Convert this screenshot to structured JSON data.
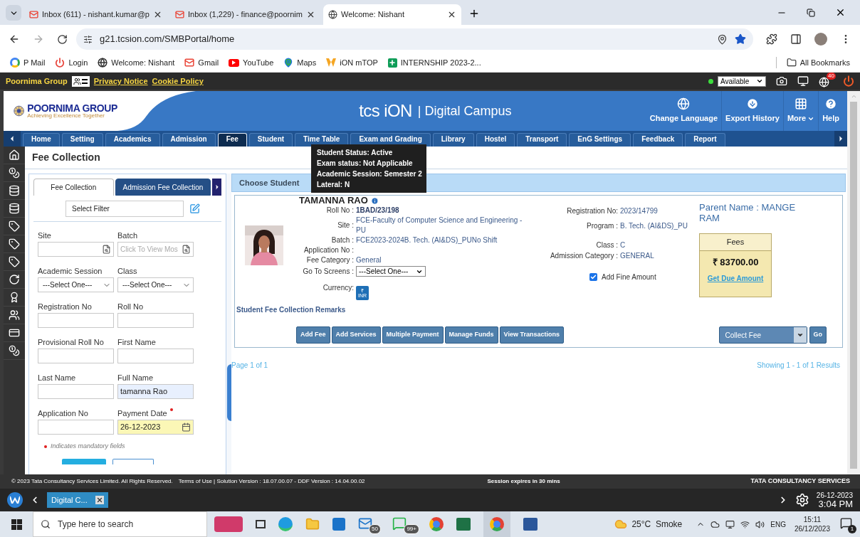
{
  "browser": {
    "tabs": [
      {
        "title": "Inbox (611) - nishant.kumar@p",
        "selected": false,
        "kind": "mail"
      },
      {
        "title": "Inbox (1,229) - finance@poornim",
        "selected": false,
        "kind": "mail"
      },
      {
        "title": "Welcome: Nishant",
        "selected": true,
        "kind": "globe"
      }
    ],
    "address": "g21.tcsion.com/SMBPortal/home",
    "bookmarks": [
      {
        "label": "P Mail",
        "kind": "google"
      },
      {
        "label": "Login",
        "kind": "power"
      },
      {
        "label": "Welcome: Nishant",
        "kind": "globe"
      },
      {
        "label": "Gmail",
        "kind": "mail"
      },
      {
        "label": "YouTube",
        "kind": "youtube"
      },
      {
        "label": "Maps",
        "kind": "maps"
      },
      {
        "label": "iON mTOP",
        "kind": "ion"
      },
      {
        "label": "INTERNSHIP 2023-2...",
        "kind": "sheet"
      }
    ],
    "all_bookmarks": "All Bookmarks"
  },
  "portal_bar": {
    "org": "Poornima Group",
    "links": [
      "Privacy Notice",
      "Cookie Policy"
    ],
    "status": "Available",
    "notification_count": "40"
  },
  "header": {
    "logo_name": "POORNIMA GROUP",
    "logo_tagline": "Achieving Excellence Together",
    "brand": "tcs iON",
    "product": "| Digital Campus",
    "actions": [
      {
        "label": "Change Language",
        "kind": "globe"
      },
      {
        "label": "Export History",
        "kind": "download"
      },
      {
        "label": "More",
        "kind": "grid"
      },
      {
        "label": "Help",
        "kind": "help"
      }
    ]
  },
  "nav": [
    {
      "label": "Home",
      "selected": false
    },
    {
      "label": "Setting",
      "selected": false
    },
    {
      "label": "Academics",
      "selected": false
    },
    {
      "label": "Admission",
      "selected": false
    },
    {
      "label": "Fee",
      "selected": true
    },
    {
      "label": "Student",
      "selected": false
    },
    {
      "label": "Time Table",
      "selected": false
    },
    {
      "label": "Exam and Grading",
      "selected": false
    },
    {
      "label": "Library",
      "selected": false
    },
    {
      "label": "Hostel",
      "selected": false
    },
    {
      "label": "Transport",
      "selected": false
    },
    {
      "label": "EnG Settings",
      "selected": false
    },
    {
      "label": "Feedback",
      "selected": false
    },
    {
      "label": "Report",
      "selected": false
    }
  ],
  "page_title": "Fee Collection",
  "filter_panel": {
    "tabs": [
      {
        "label": "Fee Collection",
        "selected": true
      },
      {
        "label": "Admission Fee Collection",
        "selected": false
      }
    ],
    "filter": "Select Filter",
    "fields": [
      {
        "label": "Site",
        "kind": "lookup",
        "required": false,
        "autofilled": false
      },
      {
        "label": "Batch",
        "kind": "lookup",
        "placeholder": "Click To View Mos",
        "required": false,
        "autofilled": false
      },
      {
        "label": "Academic Session",
        "kind": "select",
        "value": "---Select One---",
        "required": false,
        "autofilled": false
      },
      {
        "label": "Class",
        "kind": "select",
        "value": "---Select One---",
        "required": false,
        "autofilled": false
      },
      {
        "label": "Registration No",
        "kind": "text",
        "required": false,
        "autofilled": false
      },
      {
        "label": "Roll No",
        "kind": "text",
        "required": false,
        "autofilled": false
      },
      {
        "label": "Provisional Roll No",
        "kind": "text",
        "required": false,
        "autofilled": false
      },
      {
        "label": "First Name",
        "kind": "text",
        "required": false,
        "autofilled": false
      },
      {
        "label": "Last Name",
        "kind": "text",
        "required": false,
        "autofilled": false
      },
      {
        "label": "Full Name",
        "kind": "text",
        "value": "tamanna Rao",
        "required": false,
        "autofilled": true
      },
      {
        "label": "Application No",
        "kind": "text",
        "required": false,
        "autofilled": false
      },
      {
        "label": "Payment Date",
        "kind": "date",
        "value": "26-12-2023",
        "required": true,
        "autofilled": false
      }
    ],
    "mandatory_note": "Indicates mandatory fields"
  },
  "student_panel": {
    "title": "Choose Student",
    "name": "TAMANNA RAO",
    "details_left": [
      {
        "label": "Roll No :",
        "value": "1BAD/23/198",
        "kind": "bold"
      },
      {
        "label": "Site :",
        "value": "FCE-Faculty of Computer Science and Engineering - PU",
        "kind": "text"
      },
      {
        "label": "Batch :",
        "value": "FCE2023-2024B. Tech. (AI&DS)_PUNo Shift",
        "kind": "text"
      },
      {
        "label": "Application No :",
        "kind": "text"
      },
      {
        "label": "Fee Category :",
        "value": "General",
        "kind": "text"
      },
      {
        "label": "Go To Screens :",
        "value": "---Select One---",
        "kind": "select"
      },
      {
        "label": "Currency:",
        "value": "INR",
        "symbol": "₹",
        "kind": "currency"
      }
    ],
    "details_right": [
      {
        "label": "Registration No:",
        "value": "2023/14799"
      },
      {
        "label": "Program :",
        "value": "B. Tech. (AI&DS)_PU"
      },
      {
        "label": "Class :",
        "value": "C"
      },
      {
        "label": "Admission Category :",
        "value": "GENERAL"
      }
    ],
    "add_fine": {
      "label": "Add Fine Amount",
      "checked": true
    },
    "parent": "Parent Name : MANGE RAM",
    "fees": {
      "title": "Fees",
      "amount": "₹ 83700.00",
      "link": "Get Due Amount"
    },
    "remarks": "Student Fee Collection Remarks",
    "buttons": [
      "Add Fee",
      "Add Services",
      "Multiple Payment",
      "Manage Funds",
      "View Transactions"
    ],
    "action_select": "Collect Fee",
    "go": "Go",
    "page_info": "Page 1 of 1",
    "results": "Showing 1 - 1 of 1 Results"
  },
  "tooltip": [
    "Student Status: Active",
    "Exam status: Not Applicable",
    "Academic Session: Semester 2",
    "Lateral: N"
  ],
  "footer": {
    "copyright": "© 2023 Tata Consultancy Services Limited. All Rights Reserved.",
    "versions": "Terms of Use | Solution Version : 18.07.00.07 - DDF Version : 14.04.00.02",
    "session": "Session expires in 30 mins",
    "company": "TATA CONSULTANCY SERVICES"
  },
  "app_bar": {
    "tab": "Digital C...",
    "date": "26-12-2023",
    "time": "3:04 PM"
  },
  "taskbar": {
    "search": "Type here to search",
    "mail_badge": "50",
    "whatsapp_badge": "99+",
    "weather": "25°C  Smoke",
    "language": "ENG",
    "time": "15:11",
    "date": "26/12/2023",
    "notifications": "1"
  }
}
